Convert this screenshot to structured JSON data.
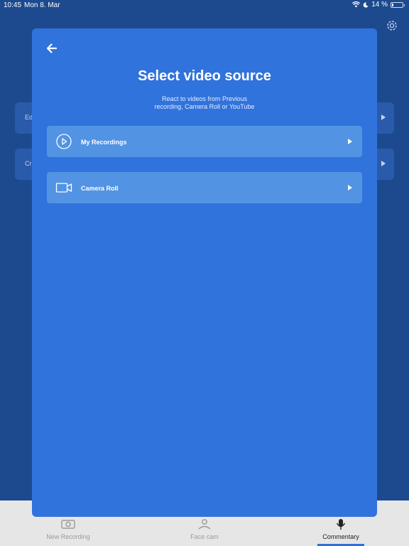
{
  "status_bar": {
    "time": "10:45",
    "date": "Mon 8. Mar",
    "battery": "14 %",
    "icons": [
      "wifi-icon",
      "moon-icon",
      "battery-icon"
    ]
  },
  "background": {
    "cards": [
      {
        "label": "Ed"
      },
      {
        "label": "Cr"
      }
    ],
    "tabs": [
      {
        "label": "New Recording",
        "icon": "camera-plus-icon"
      },
      {
        "label": "Face cam",
        "icon": "face-cam-icon"
      },
      {
        "label": "Commentary",
        "icon": "microphone-icon"
      }
    ]
  },
  "modal": {
    "title": "Select video source",
    "subtitle_line1": "React to videos from Previous",
    "subtitle_line2": "recording, Camera Roll or YouTube",
    "options": [
      {
        "label": "My Recordings",
        "icon": "play-circle-icon"
      },
      {
        "label": "Camera Roll",
        "icon": "video-camera-icon"
      }
    ]
  },
  "colors": {
    "modal_bg": "#3173dc",
    "option_bg": "#5293e4",
    "backdrop": "#1d4a8f",
    "tab_bar": "#e6e6e6"
  }
}
